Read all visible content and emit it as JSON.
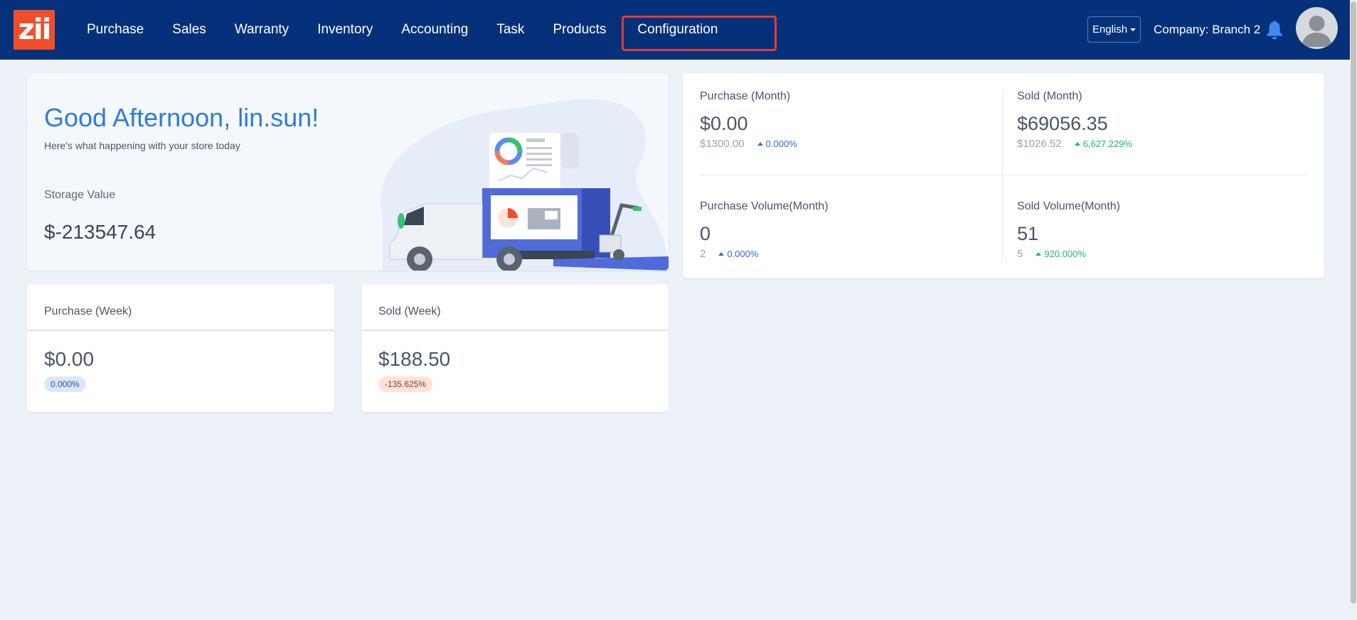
{
  "app": {
    "logo_text": "zii"
  },
  "nav": {
    "items": [
      {
        "label": "Purchase"
      },
      {
        "label": "Sales"
      },
      {
        "label": "Warranty"
      },
      {
        "label": "Inventory"
      },
      {
        "label": "Accounting"
      },
      {
        "label": "Task"
      },
      {
        "label": "Products"
      },
      {
        "label": "Configuration"
      }
    ]
  },
  "header": {
    "language": "English",
    "company": "Company: Branch 2"
  },
  "greeting": {
    "title": "Good Afternoon, lin.sun!",
    "subtitle": "Here's what happening with your store today",
    "storage_label": "Storage Value",
    "storage_value": "$-213547.64"
  },
  "monthly": {
    "purchase": {
      "label": "Purchase (Month)",
      "value": "$0.00",
      "previous": "$1300.00",
      "change": "0.000%"
    },
    "sold": {
      "label": "Sold (Month)",
      "value": "$69056.35",
      "previous": "$1026.52",
      "change": "6,627.229%"
    },
    "purchase_volume": {
      "label": "Purchase Volume(Month)",
      "value": "0",
      "previous": "2",
      "change": "0.000%"
    },
    "sold_volume": {
      "label": "Sold Volume(Month)",
      "value": "51",
      "previous": "5",
      "change": "920.000%"
    }
  },
  "weekly": {
    "purchase": {
      "label": "Purchase (Week)",
      "value": "$0.00",
      "change": "0.000%"
    },
    "sold": {
      "label": "Sold (Week)",
      "value": "$188.50",
      "change": "-135.625%"
    }
  },
  "colors": {
    "nav_bg": "#05317a",
    "accent_blue": "#2f7dd8",
    "highlight_red": "#e53935",
    "positive_green": "#1cba6a",
    "logo_orange": "#f04e2a"
  }
}
